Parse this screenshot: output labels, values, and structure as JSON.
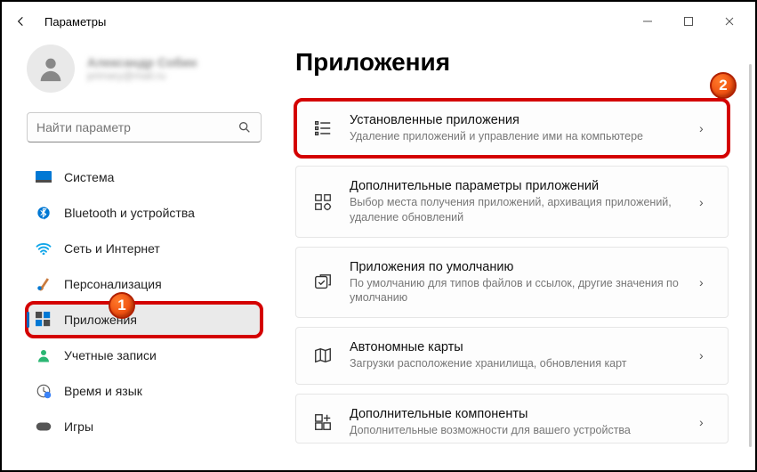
{
  "window": {
    "title": "Параметры"
  },
  "user": {
    "name": "Александр Собин",
    "email": "primary@mail.ru"
  },
  "search": {
    "placeholder": "Найти параметр"
  },
  "sidebar": {
    "items": [
      {
        "label": "Система"
      },
      {
        "label": "Bluetooth и устройства"
      },
      {
        "label": "Сеть и Интернет"
      },
      {
        "label": "Персонализация"
      },
      {
        "label": "Приложения"
      },
      {
        "label": "Учетные записи"
      },
      {
        "label": "Время и язык"
      },
      {
        "label": "Игры"
      }
    ]
  },
  "page": {
    "title": "Приложения"
  },
  "cards": [
    {
      "title": "Установленные приложения",
      "sub": "Удаление приложений и управление ими на компьютере"
    },
    {
      "title": "Дополнительные параметры приложений",
      "sub": "Выбор места получения приложений, архивация приложений, удаление обновлений"
    },
    {
      "title": "Приложения по умолчанию",
      "sub": "По умолчанию для типов файлов и ссылок, другие значения по умолчанию"
    },
    {
      "title": "Автономные карты",
      "sub": "Загрузки расположение хранилища, обновления карт"
    },
    {
      "title": "Дополнительные компоненты",
      "sub": "Дополнительные возможности для вашего устройства"
    }
  ],
  "annotations": {
    "badge1": "1",
    "badge2": "2"
  }
}
